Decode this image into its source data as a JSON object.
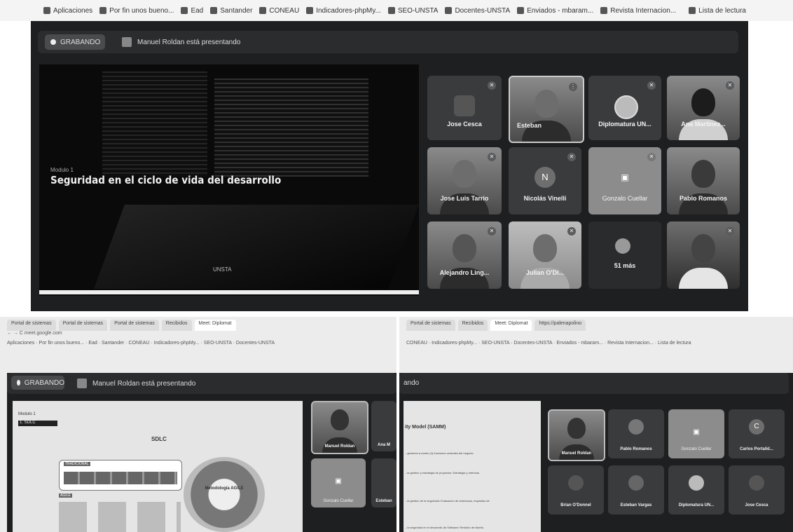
{
  "bookmarks": [
    "Aplicaciones",
    "Por fin unos bueno...",
    "Ead",
    "Santander",
    "CONEAU",
    "Indicadores-phpMy...",
    "SEO-UNSTA",
    "Docentes-UNSTA",
    "Enviados - mbaram...",
    "Revista Internacion...",
    "Lista de lectura"
  ],
  "main": {
    "recording_label": "GRABANDO",
    "presenting_text": "Manuel Roldan está presentando",
    "slide": {
      "module": "Modulo 1",
      "title": "Seguridad en el ciclo de vida del desarrollo",
      "logo": "UNSTA"
    },
    "participants": [
      {
        "name": "Jose Cesca"
      },
      {
        "name": "Esteban"
      },
      {
        "name": "Diplomatura UN..."
      },
      {
        "name": "Ana Martinez..."
      },
      {
        "name": "Jose Luis Tarrio"
      },
      {
        "name": "Nicolás Vinelli",
        "initial": "N"
      },
      {
        "name": "Gonzalo Cuellar"
      },
      {
        "name": "Pablo Romanos"
      },
      {
        "name": "Alejandro Ling..."
      },
      {
        "name": "Julian O'Di..."
      },
      {
        "name": "51 más"
      },
      {
        "name": ""
      }
    ]
  },
  "bottom_left": {
    "recording_label": "GRABANDO",
    "presenting_text": "Manuel Roldan está presentando",
    "slide_title": "SDLC",
    "slide_module": "Modulo 1",
    "slide_sub": "1. SDLC",
    "tradicional": "TRADICIONAL",
    "agile": "AGILE",
    "agile_center": "Metodología AGILE",
    "participants": [
      {
        "name": "Manuel Roldan"
      },
      {
        "name": "Ana M"
      },
      {
        "name": "Gonzalo Cuellar"
      },
      {
        "name": "Esteban"
      }
    ]
  },
  "bottom_right": {
    "presenting_text": "ando",
    "slide_title": "ity Model (SAMM)",
    "slide_lines": [
      "...gestores a cuatro (4) funciones centrales del negocio:",
      "...la gestion y estrategia de proyectos: Estrategia y métricas.",
      "...la gestion de la seguridad: Evaluación de amenazas, requisitos de",
      "...la seguridad en el desarrollo de Software: Revisión de diseño."
    ],
    "participants": [
      {
        "name": "Manuel Roldan"
      },
      {
        "name": "Pablo Romanos"
      },
      {
        "name": "Gonzalo Cuellar"
      },
      {
        "name": "Carlos Portalid..."
      },
      {
        "name": "Brian O'Donnel"
      },
      {
        "name": "Esteban Vargas"
      },
      {
        "name": "Diplomatura UN..."
      },
      {
        "name": "Jose Cesca"
      }
    ]
  }
}
